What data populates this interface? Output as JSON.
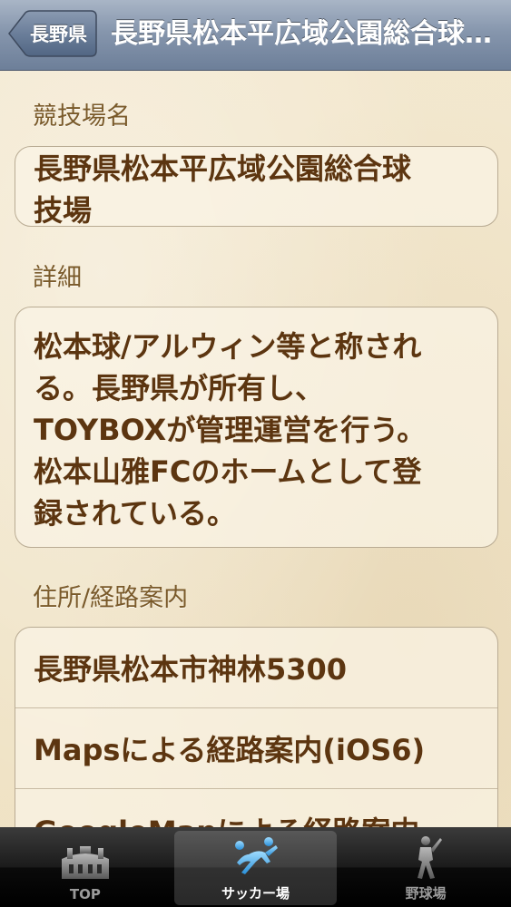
{
  "navbar": {
    "back_label": "長野県",
    "title": "長野県松本平広域公園総合球技場"
  },
  "sections": {
    "venue_name": {
      "label": "競技場名",
      "lines": [
        "長野県松本平広域公園総合球",
        "技場"
      ]
    },
    "details": {
      "label": "詳細",
      "lines": [
        "松本球/アルウィン等と称され",
        "る。長野県が所有し、",
        "TOYBOXが管理運営を行う。",
        "松本山雅FCのホームとして登",
        "録されている。"
      ]
    },
    "address": {
      "label": "住所/経路案内",
      "rows": [
        "長野県松本市神林5300",
        "Mapsによる経路案内(iOS6)",
        "GoogleMapによる経路案内"
      ]
    }
  },
  "tabbar": {
    "tabs": [
      {
        "label": "TOP",
        "icon": "stadium-icon",
        "active": false
      },
      {
        "label": "サッカー場",
        "icon": "soccer-player-icon",
        "active": true
      },
      {
        "label": "野球場",
        "icon": "baseball-player-icon",
        "active": false
      }
    ]
  },
  "colors": {
    "navbar": "#8696ad",
    "text_brown": "#5c3510",
    "label_brown": "#7a5a2a",
    "background": "#f1e6cc",
    "active_tab_icon": "#4fb3f0"
  }
}
